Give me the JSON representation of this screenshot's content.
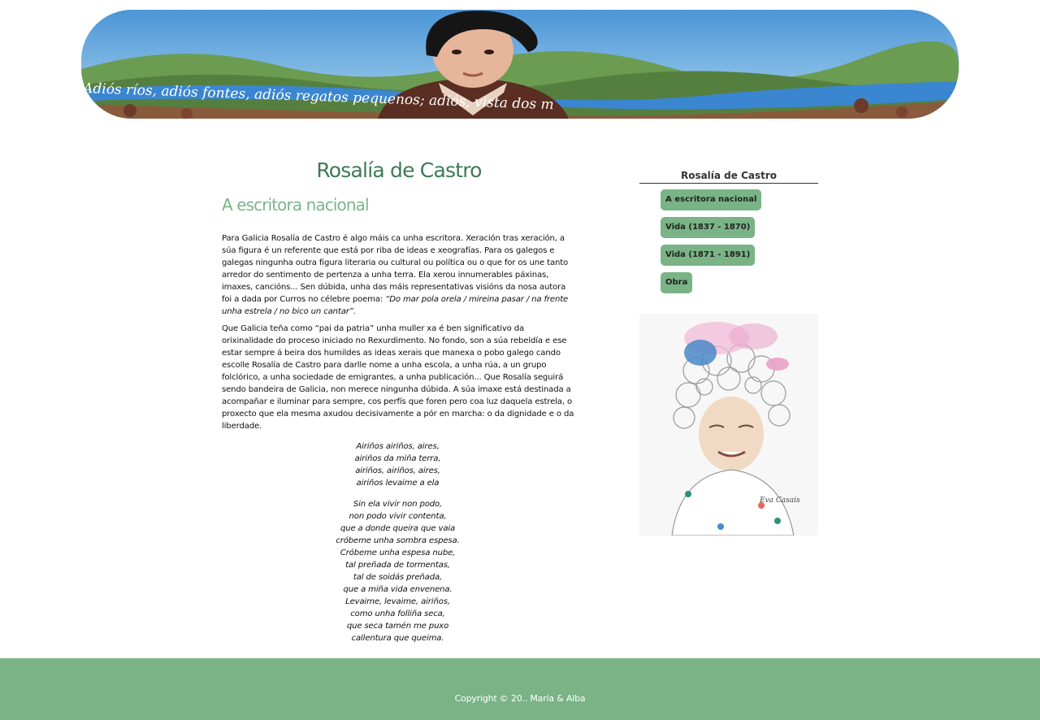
{
  "banner": {
    "script_text": "Adiós ríos, adiós fontes, adiós regatos pequenos; adiós, vista dos m"
  },
  "main": {
    "title": "Rosalía de Castro",
    "section_title": "A escritora nacional",
    "paragraph1": "Para Galicia Rosalía de Castro é algo máis ca unha escritora. Xeración tras xeración, a súa figura é un referente que está por riba de ideas e xeografías. Para os galegos e galegas ningunha outra figura literaria ou cultural ou política ou o que for os une tanto arredor do sentimento de pertenza a unha terra. Ela xerou innumerables páxinas, imaxes, cancións... Sen dúbida, unha das máis representativas visións da nosa autora foi a dada por Curros no célebre poema: ",
    "paragraph1_quote": "“Do mar pola orela / mireina pasar / na frente unha estrela / no bico un cantar”.",
    "paragraph2": "Que Galicia teña como “pai da patria” unha muller xa é ben significativo da orixinalidade do proceso iniciado no Rexurdimento. No fondo, son a súa rebeldía e ese estar sempre á beira dos humildes as ideas xerais que manexa o pobo galego cando escolle Rosalía de Castro para darlle nome a unha escola, a unha rúa, a un grupo folclórico, a unha sociedade de emigrantes, a unha publicación... Que Rosalía seguirá sendo bandeira de Galicia, non merece ningunha dúbida. A súa imaxe está destinada a acompañar e iluminar para sempre, cos perfís que foren pero coa luz daquela estrela, o proxecto que ela mesma axudou decisivamente a pór en marcha: o da dignidade e o da liberdade.",
    "poem_stanza1": [
      "Airiños airiños, aires,",
      "airiños da miña terra,",
      "airiños, airiños, aires,",
      "airiños levaime a ela"
    ],
    "poem_stanza2": [
      "Sin ela vivir non podo,",
      "non podo vivir contenta,",
      "que a donde queira que vaia",
      "cróbeme unha sombra espesa.",
      "Cróbeme unha espesa nube,",
      "tal preñada de tormentas,",
      "tal de soidás preñada,",
      "que a miña vida envenena.",
      "Levaime, levaime, airiños,",
      "como unha folliña seca,",
      "que seca tamén me puxo",
      "callentura que queima."
    ]
  },
  "sidebar": {
    "title": "Rosalía de Castro",
    "nav": [
      {
        "label": "A escritora nacional"
      },
      {
        "label": "Vida (1837 - 1870)"
      },
      {
        "label": "Vida (1871 - 1891)"
      },
      {
        "label": "Obra"
      }
    ],
    "portrait_signature": "Eva Casais"
  },
  "footer": {
    "copyright": "Copyright © 20.. María & Alba"
  },
  "colors": {
    "green_dark": "#3d7a57",
    "green_light": "#79b386",
    "footer_bg": "#79b386"
  }
}
